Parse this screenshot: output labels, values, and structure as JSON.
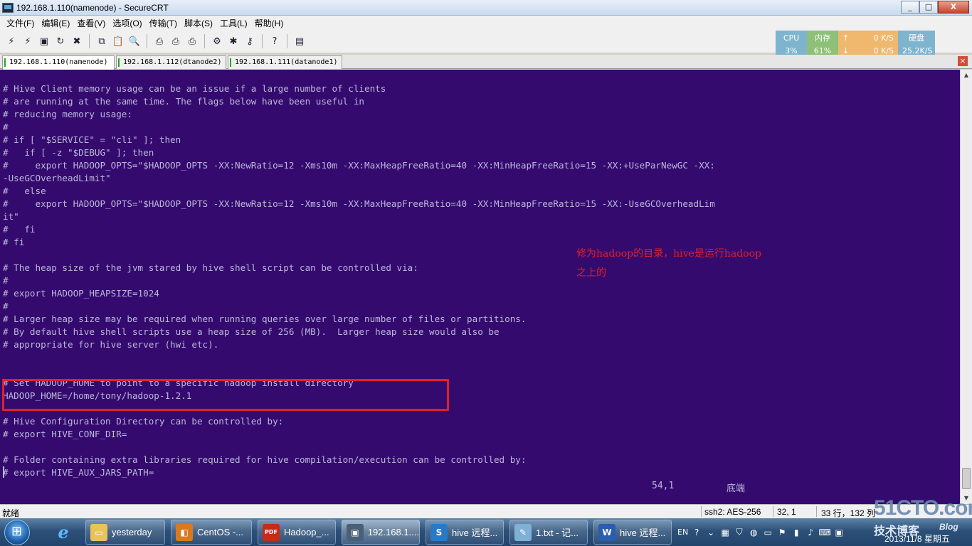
{
  "window": {
    "title": "192.168.1.110(namenode) - SecureCRT",
    "controls": [
      "_",
      "□",
      "X"
    ]
  },
  "menu": [
    "文件(F)",
    "编辑(E)",
    "查看(V)",
    "选项(O)",
    "传输(T)",
    "脚本(S)",
    "工具(L)",
    "帮助(H)"
  ],
  "toolbar": {
    "icons": [
      "connect-icon",
      "quick-connect-icon",
      "connect-tab-icon",
      "reconnect-icon",
      "disconnect-icon",
      "copy-icon",
      "paste-icon",
      "find-icon",
      "print-setup-icon",
      "print-icon",
      "print-screen-icon",
      "session-options-icon",
      "global-options-icon",
      "keymap-icon",
      "help-icon",
      "sftp-icon"
    ],
    "glyphs": [
      "⚡",
      "⚡",
      "▣",
      "↻",
      "✖",
      "⧉",
      "📋",
      "🔍",
      "⎙",
      "⎙",
      "⎙",
      "⚙",
      "✱",
      "⚷",
      "?",
      "▤"
    ]
  },
  "sysmon": {
    "cpu_label": "CPU",
    "cpu_value": "3%",
    "mem_label": "内存",
    "mem_value": "61%",
    "net_up": "0 K/S",
    "net_down": "0 K/S",
    "disk_label": "硬盘",
    "disk_value": "25.2K/S"
  },
  "tabs": [
    {
      "label": "192.168.1.110(namenode)",
      "active": true
    },
    {
      "label": "192.168.1.112(dtanode2)",
      "active": false
    },
    {
      "label": "192.168.1.111(datanode1)",
      "active": false
    }
  ],
  "terminal": {
    "lines": [
      "# Hive Client memory usage can be an issue if a large number of clients",
      "# are running at the same time. The flags below have been useful in",
      "# reducing memory usage:",
      "#",
      "# if [ \"$SERVICE\" = \"cli\" ]; then",
      "#   if [ -z \"$DEBUG\" ]; then",
      "#     export HADOOP_OPTS=\"$HADOOP_OPTS -XX:NewRatio=12 -Xms10m -XX:MaxHeapFreeRatio=40 -XX:MinHeapFreeRatio=15 -XX:+UseParNewGC -XX:",
      "-UseGCOverheadLimit\"",
      "#   else",
      "#     export HADOOP_OPTS=\"$HADOOP_OPTS -XX:NewRatio=12 -Xms10m -XX:MaxHeapFreeRatio=40 -XX:MinHeapFreeRatio=15 -XX:-UseGCOverheadLim",
      "it\"",
      "#   fi",
      "# fi",
      "",
      "# The heap size of the jvm stared by hive shell script can be controlled via:",
      "#",
      "# export HADOOP_HEAPSIZE=1024",
      "#",
      "# Larger heap size may be required when running queries over large number of files or partitions.",
      "# By default hive shell scripts use a heap size of 256 (MB).  Larger heap size would also be",
      "# appropriate for hive server (hwi etc).",
      "",
      "",
      "# Set HADOOP_HOME to point to a specific hadoop install directory",
      "HADOOP_HOME=/home/tony/hadoop-1.2.1",
      "",
      "# Hive Configuration Directory can be controlled by:",
      "# export HIVE_CONF_DIR=",
      "",
      "# Folder containing extra libraries required for hive compilation/execution can be controlled by:",
      "# export HIVE_AUX_JARS_PATH="
    ],
    "annotation_line1": "修为hadoop的目录，hive是运行hadoop",
    "annotation_line2": "之上的",
    "position": "54,1",
    "position_label": "底端"
  },
  "statusbar": {
    "ready": "就绪",
    "protocol": "ssh2: AES-256",
    "cursor": "32,  1",
    "size": "33 行，132 列"
  },
  "taskbar": {
    "items": [
      {
        "label": "yesterday",
        "icon": "folder-icon",
        "color": "#e8c35a",
        "glyph": "▭"
      },
      {
        "label": "CentOS -...",
        "icon": "vmware-icon",
        "color": "#d97a1e",
        "glyph": "◧"
      },
      {
        "label": "Hadoop_...",
        "icon": "pdf-icon",
        "color": "#c42b1c",
        "glyph": "PDF"
      },
      {
        "label": "192.168.1....",
        "icon": "securecrt-icon",
        "color": "#4a5f78",
        "glyph": "▣"
      },
      {
        "label": "hive 远程...",
        "icon": "sogou-icon",
        "color": "#2b78c5",
        "glyph": "S"
      },
      {
        "label": "1.txt - 记...",
        "icon": "notepad-icon",
        "color": "#7fb0d8",
        "glyph": "✎"
      },
      {
        "label": "hive 远程...",
        "icon": "word-icon",
        "color": "#2a5db0",
        "glyph": "W"
      }
    ],
    "tray_lang": "EN",
    "clock": "2013/11/8 星期五",
    "watermark": "51CTO.com",
    "watermark_sub": "技术博客",
    "watermark_blog": "Blog"
  }
}
